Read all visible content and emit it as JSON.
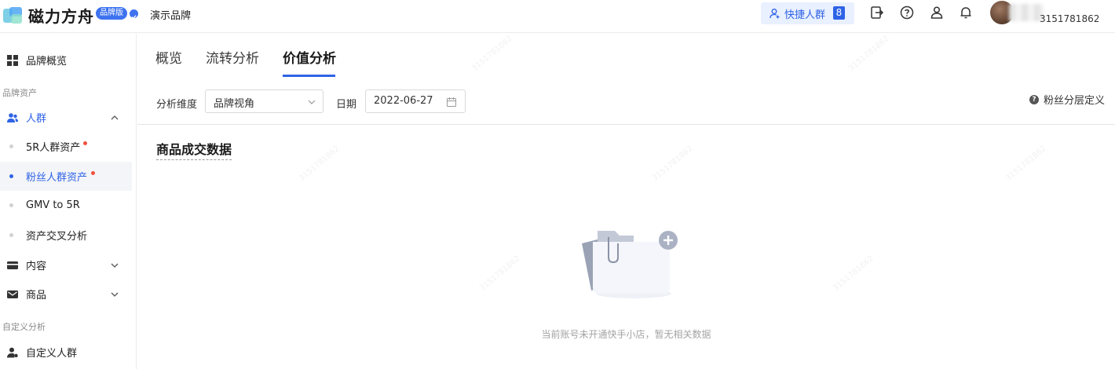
{
  "header": {
    "logo_text": "磁力方舟",
    "edition_badge": "品牌版",
    "brand_name": "演示品牌",
    "quick_crowd_label": "快捷人群",
    "quick_crowd_count": "8",
    "user_id": "3151781862"
  },
  "sidebar": {
    "overview": "品牌概览",
    "section_assets": "品牌资产",
    "crowd": "人群",
    "sub_items": [
      {
        "label": "5R人群资产",
        "new": true
      },
      {
        "label": "粉丝人群资产",
        "new": true,
        "active": true
      },
      {
        "label": "GMV to 5R"
      },
      {
        "label": "资产交叉分析"
      }
    ],
    "content": "内容",
    "goods": "商品",
    "section_custom": "自定义分析",
    "custom_crowd": "自定义人群"
  },
  "tabs": [
    "概览",
    "流转分析",
    "价值分析"
  ],
  "active_tab": "价值分析",
  "filters": {
    "dimension_label": "分析维度",
    "dimension_value": "品牌视角",
    "date_label": "日期",
    "date_value": "2022-06-27",
    "definition_link": "粉丝分层定义"
  },
  "section_title": "商品成交数据",
  "empty_text": "当前账号未开通快手小店，暂无相关数据",
  "watermark_text": "3151781862",
  "colors": {
    "accent": "#2e63e6",
    "active_bg": "#f4f5f8",
    "new_dot": "#f0503c"
  }
}
